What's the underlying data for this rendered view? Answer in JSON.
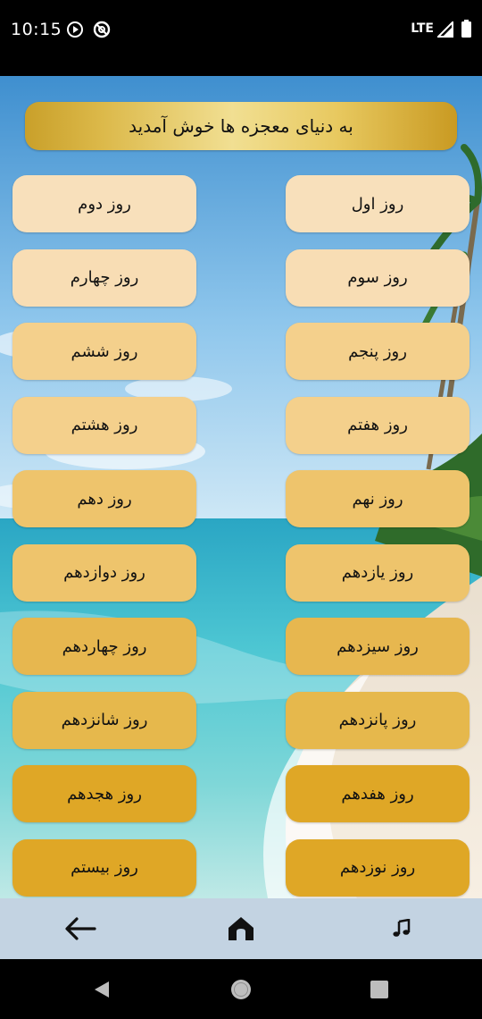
{
  "status_bar": {
    "time": "10:15",
    "network": "LTE"
  },
  "banner": {
    "text": "به دنیای معجزه ها خوش آمدید"
  },
  "days": [
    {
      "label": "روز اول"
    },
    {
      "label": "روز دوم"
    },
    {
      "label": "روز سوم"
    },
    {
      "label": "روز چهارم"
    },
    {
      "label": "روز پنجم"
    },
    {
      "label": "روز ششم"
    },
    {
      "label": "روز هفتم"
    },
    {
      "label": "روز هشتم"
    },
    {
      "label": "روز نهم"
    },
    {
      "label": "روز دهم"
    },
    {
      "label": "روز یازدهم"
    },
    {
      "label": "روز دوازدهم"
    },
    {
      "label": "روز سیزدهم"
    },
    {
      "label": "روز چهاردهم"
    },
    {
      "label": "روز پانزدهم"
    },
    {
      "label": "روز شانزدهم"
    },
    {
      "label": "روز هفدهم"
    },
    {
      "label": "روز هجدهم"
    },
    {
      "label": "روز نوزدهم"
    },
    {
      "label": "روز بیستم"
    }
  ],
  "row_colors": [
    "#f8e0bb",
    "#f8ddb4",
    "#f4d08c",
    "#f4d08c",
    "#eec46c",
    "#eec46c",
    "#e7b74f",
    "#e6b84c",
    "#dfa726",
    "#dfa726"
  ],
  "bottom_nav": {
    "back_icon": "arrow-left-icon",
    "home_icon": "home-icon",
    "music_icon": "music-note-icon"
  },
  "system_nav": {
    "back_icon": "triangle-back-icon",
    "home_icon": "circle-home-icon",
    "recents_icon": "square-recents-icon"
  }
}
